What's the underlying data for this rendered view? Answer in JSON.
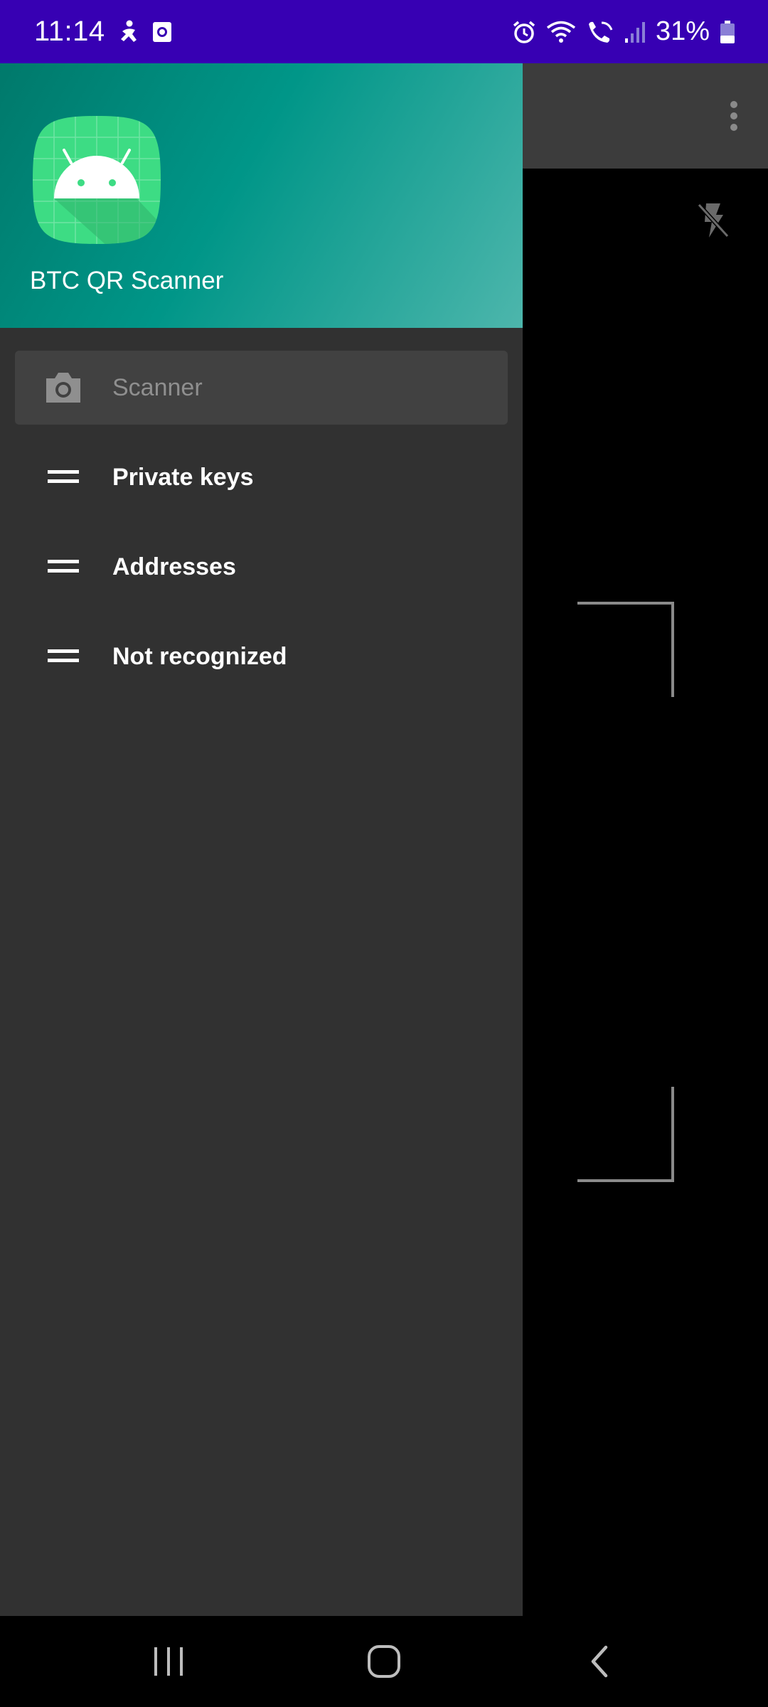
{
  "status_bar": {
    "time": "11:14",
    "battery": "31%",
    "icons": [
      "accessibility-icon",
      "screen-recorder-icon",
      "alarm-icon",
      "wifi-icon",
      "wifi-calling-icon",
      "signal-icon",
      "battery-icon"
    ]
  },
  "app": {
    "name": "BTC QR Scanner"
  },
  "drawer": {
    "items": [
      {
        "label": "Scanner",
        "icon": "camera-icon",
        "active": true
      },
      {
        "label": "Private keys",
        "icon": "list-icon",
        "active": false
      },
      {
        "label": "Addresses",
        "icon": "list-icon",
        "active": false
      },
      {
        "label": "Not recognized",
        "icon": "list-icon",
        "active": false
      }
    ]
  },
  "toolbar": {
    "overflow_icon": "more-vert-icon",
    "flash_icon": "flash-off-icon"
  },
  "nav": {
    "recents_icon": "recents-icon",
    "home_icon": "home-icon",
    "back_icon": "back-icon"
  },
  "colors": {
    "status_bar": "#3700b3",
    "drawer_bg": "#313131",
    "header_start": "#00796b",
    "header_end": "#4db6ac"
  }
}
